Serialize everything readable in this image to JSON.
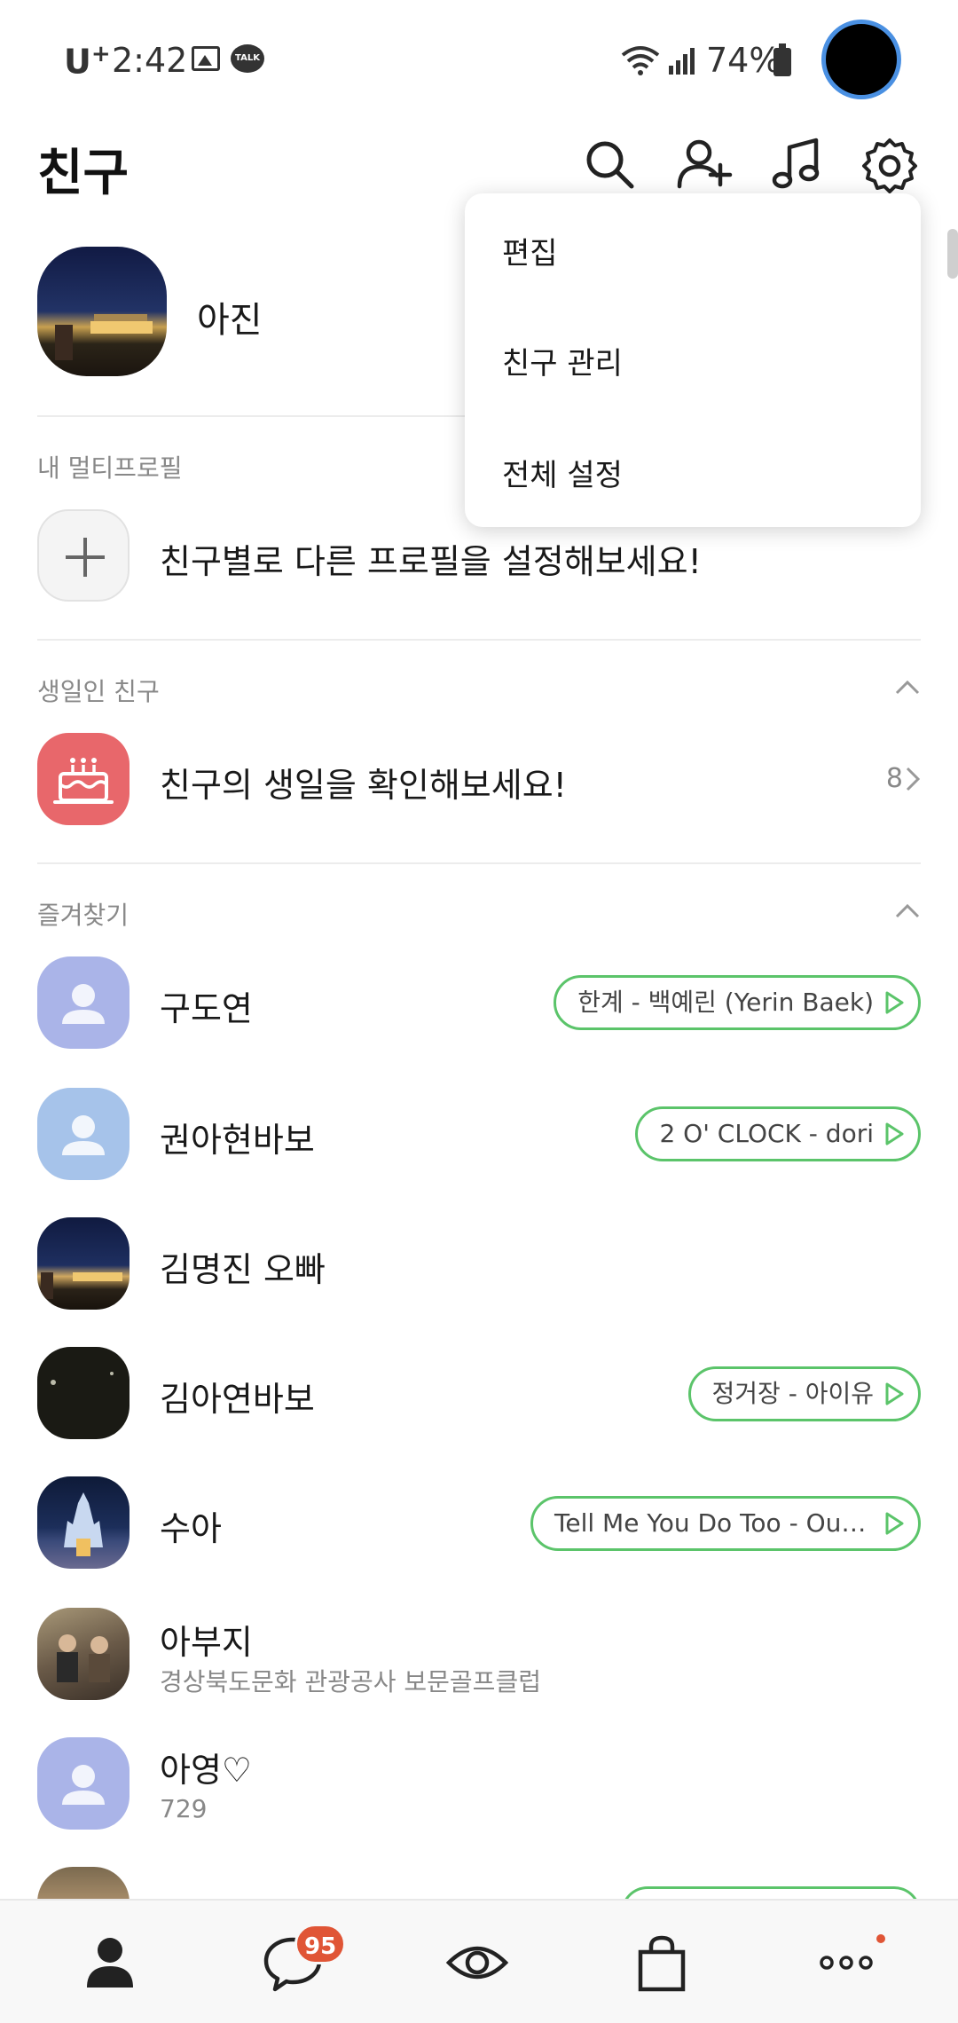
{
  "status_bar": {
    "carrier": "U",
    "carrier_sup": "+",
    "time": "2:42",
    "battery": "74%"
  },
  "header": {
    "title": "친구",
    "icons": [
      "search-icon",
      "add-friend-icon",
      "music-icon",
      "settings-icon"
    ]
  },
  "my_profile": {
    "name": "아진"
  },
  "dropdown_menu": {
    "items": [
      "편집",
      "친구 관리",
      "전체 설정"
    ]
  },
  "multi_profile": {
    "section_label": "내 멀티프로필",
    "prompt": "친구별로 다른 프로필을 설정해보세요!"
  },
  "birthday": {
    "section_label": "생일인 친구",
    "prompt": "친구의 생일을 확인해보세요!",
    "count": "8"
  },
  "favorites": {
    "section_label": "즐겨찾기",
    "friends": [
      {
        "name": "구도연",
        "music": "한계 - 백예린 (Yerin Baek)",
        "status": ""
      },
      {
        "name": "권아현바보",
        "music": "2 O' CLOCK - dori",
        "status": ""
      },
      {
        "name": "김명진 오빠",
        "music": "",
        "status": ""
      },
      {
        "name": "김아연바보",
        "music": "정거장 - 아이유",
        "status": ""
      },
      {
        "name": "수아",
        "music": "Tell Me You Do Too - OuYa...",
        "status": ""
      },
      {
        "name": "아부지",
        "music": "",
        "status": "경상북도문화 관광공사 보문골프클럽"
      },
      {
        "name": "아영♡",
        "music": "",
        "status": "729"
      }
    ]
  },
  "bottom_nav": {
    "items": [
      "friends-tab",
      "chats-tab",
      "view-tab",
      "shopping-tab",
      "more-tab"
    ],
    "chat_badge": "95"
  },
  "colors": {
    "accent_green": "#5bc46a",
    "badge_red": "#e05536",
    "birthday_red": "#e8676b"
  }
}
